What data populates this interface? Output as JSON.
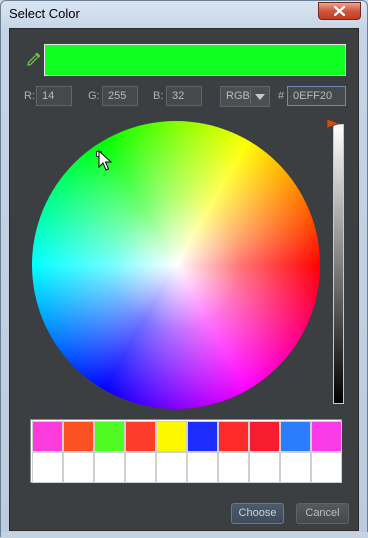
{
  "window": {
    "title": "Select Color"
  },
  "preview": {
    "color": "#0eff20"
  },
  "fields": {
    "r_label": "R:",
    "r_value": "14",
    "g_label": "G:",
    "g_value": "255",
    "b_label": "B:",
    "b_value": "32",
    "mode_value": "RGB",
    "hash_label": "#",
    "hex_value": "0EFF20"
  },
  "palette": {
    "recent": [
      "#fc3bdc",
      "#fc5023",
      "#4efc23",
      "#fc3d2b",
      "#fcf800",
      "#1c2cfc",
      "#fc2a2a",
      "#f81c30",
      "#2a7dfc",
      "#fc3be8"
    ],
    "custom": [
      "#ffffff",
      "#ffffff",
      "#ffffff",
      "#ffffff",
      "#ffffff",
      "#ffffff",
      "#ffffff",
      "#ffffff",
      "#ffffff",
      "#ffffff"
    ]
  },
  "buttons": {
    "choose": "Choose",
    "cancel": "Cancel"
  },
  "icons": {
    "eyedropper": "eyedropper-icon",
    "close": "close-icon",
    "cursor": "mouse-pointer-icon"
  }
}
